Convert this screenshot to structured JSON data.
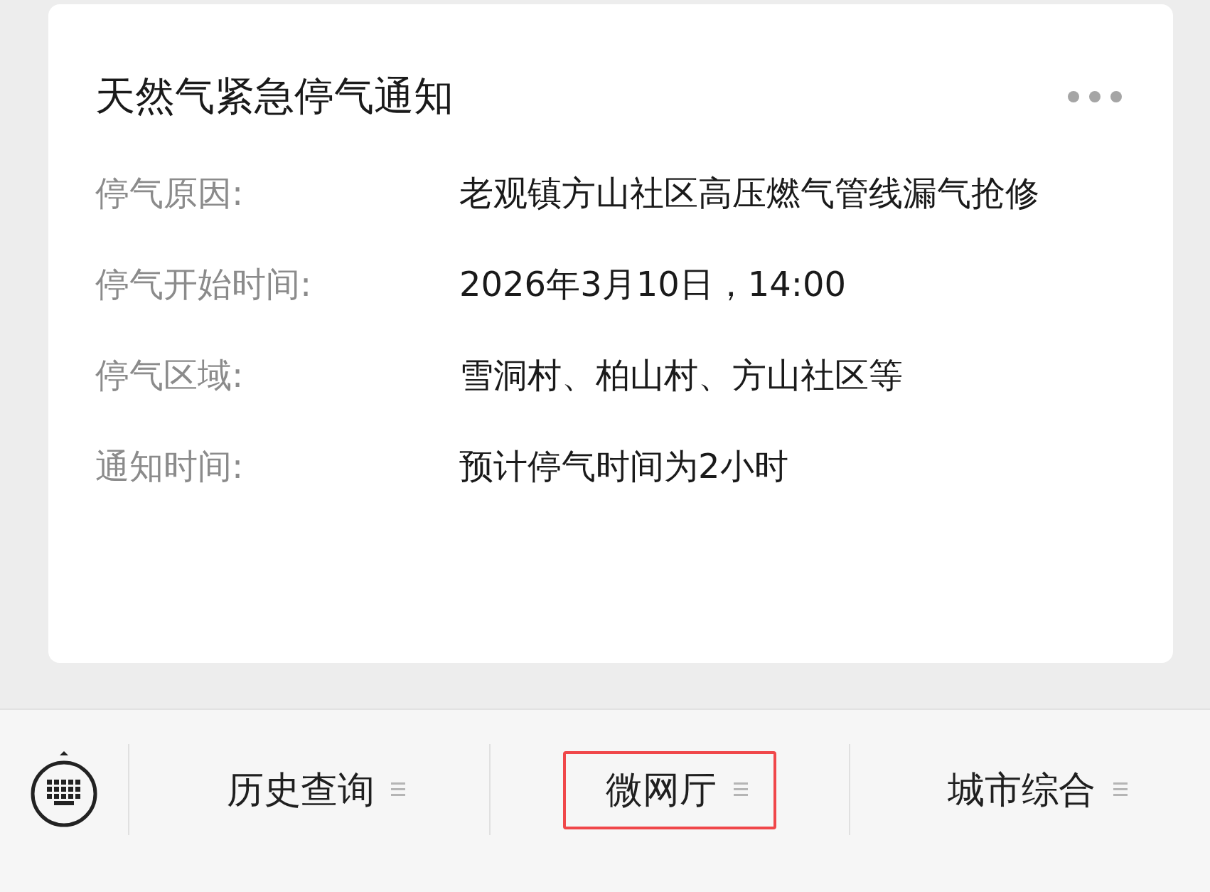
{
  "notice": {
    "title": "天然气紧急停气通知",
    "fields": [
      {
        "label": "停气原因:",
        "value": "老观镇方山社区高压燃气管线漏气抢修"
      },
      {
        "label": "停气开始时间:",
        "value": "2026年3月10日，14:00"
      },
      {
        "label": "停气区域:",
        "value": "雪洞村、柏山村、方山社区等"
      },
      {
        "label": "通知时间:",
        "value": "预计停气时间为2小时"
      }
    ]
  },
  "menu_bar": {
    "items": [
      {
        "label": "历史查询",
        "highlighted": false
      },
      {
        "label": "微网厅",
        "highlighted": true
      },
      {
        "label": "城市综合",
        "highlighted": false
      }
    ]
  }
}
